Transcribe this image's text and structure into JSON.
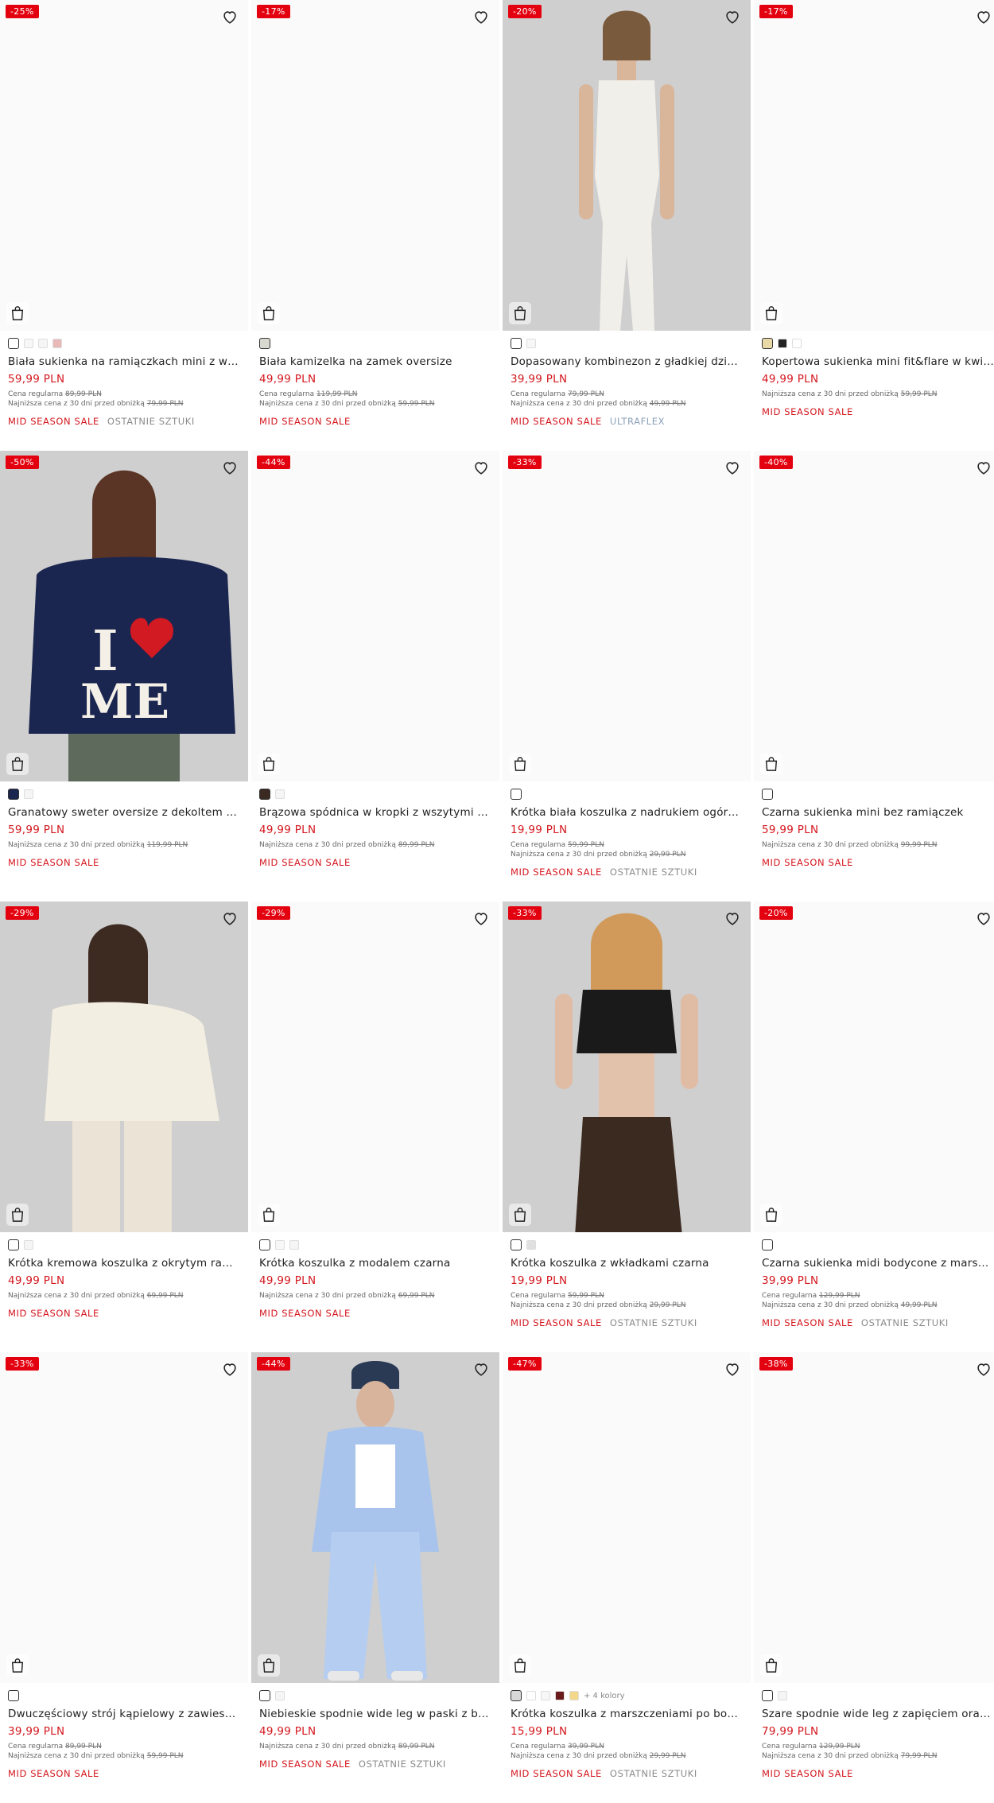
{
  "colors": {
    "accent": "#d4161d",
    "badge": "#e3000f"
  },
  "products": [
    {
      "discount": "-25%",
      "title": "Biała sukienka na ramiączkach mini z wiskozy",
      "price": "59,99 PLN",
      "regular_label": "Cena regularna",
      "regular_price": "89,99 PLN",
      "lowest_label": "Najniższa cena z 30 dni przed obniżką",
      "lowest_price": "79,99 PLN",
      "tag_sale": "MID SEASON SALE",
      "tag_extra": "OSTATNIE SZTUKI",
      "photo": false,
      "swatches": [
        "#ffffff",
        "#f7f7f7",
        "#f5f5f5",
        "#e8b9b9"
      ]
    },
    {
      "discount": "-17%",
      "title": "Biała kamizelka na zamek oversize",
      "price": "49,99 PLN",
      "regular_label": "Cena regularna",
      "regular_price": "119,99 PLN",
      "lowest_label": "Najniższa cena z 30 dni przed obniżką",
      "lowest_price": "59,99 PLN",
      "tag_sale": "MID SEASON SALE",
      "tag_extra": "",
      "photo": false,
      "swatches": [
        "#d8d8d0"
      ]
    },
    {
      "discount": "-20%",
      "title": "Dopasowany kombinezon z gładkiej dzianiny ULTRAFLEX",
      "price": "39,99 PLN",
      "regular_label": "Cena regularna",
      "regular_price": "79,99 PLN",
      "lowest_label": "Najniższa cena z 30 dni przed obniżką",
      "lowest_price": "49,99 PLN",
      "tag_sale": "MID SEASON SALE",
      "tag_extra": "ULTRAFLEX",
      "photo": true,
      "swatches": [
        "#ffffff",
        "#f7f7f7"
      ]
    },
    {
      "discount": "-17%",
      "title": "Kopertowa sukienka mini fit&flare w kwiaty z wiskozy",
      "price": "49,99 PLN",
      "regular_label": "",
      "regular_price": "",
      "lowest_label": "Najniższa cena z 30 dni przed obniżką",
      "lowest_price": "59,99 PLN",
      "tag_sale": "MID SEASON SALE",
      "tag_extra": "",
      "photo": false,
      "swatches": [
        "#e9d9a7",
        "#222222",
        "#ffffff"
      ]
    },
    {
      "discount": "-50%",
      "title": "Granatowy sweter oversize z dekoltem open shoulder I LOVE ME",
      "price": "59,99 PLN",
      "regular_label": "",
      "regular_price": "",
      "lowest_label": "Najniższa cena z 30 dni przed obniżką",
      "lowest_price": "119,99 PLN",
      "tag_sale": "MID SEASON SALE",
      "tag_extra": "",
      "photo": true,
      "swatches": [
        "#1b2650",
        "#f5f5f5"
      ]
    },
    {
      "discount": "-44%",
      "title": "Brązowa spódnica w kropki z wszytymi spodenkami",
      "price": "49,99 PLN",
      "regular_label": "",
      "regular_price": "",
      "lowest_label": "Najniższa cena z 30 dni przed obniżką",
      "lowest_price": "89,99 PLN",
      "tag_sale": "MID SEASON SALE",
      "tag_extra": "",
      "photo": false,
      "swatches": [
        "#3b2a22",
        "#f5f5f5"
      ]
    },
    {
      "discount": "-33%",
      "title": "Krótka biała koszulka z nadrukiem ogórków",
      "price": "19,99 PLN",
      "regular_label": "Cena regularna",
      "regular_price": "59,99 PLN",
      "lowest_label": "Najniższa cena z 30 dni przed obniżką",
      "lowest_price": "29,99 PLN",
      "tag_sale": "MID SEASON SALE",
      "tag_extra": "OSTATNIE SZTUKI",
      "photo": false,
      "swatches": [
        "#ffffff"
      ]
    },
    {
      "discount": "-40%",
      "title": "Czarna sukienka mini bez ramiączek",
      "price": "59,99 PLN",
      "regular_label": "",
      "regular_price": "",
      "lowest_label": "Najniższa cena z 30 dni przed obniżką",
      "lowest_price": "99,99 PLN",
      "tag_sale": "MID SEASON SALE",
      "tag_extra": "",
      "photo": false,
      "swatches": [
        "#ffffff"
      ]
    },
    {
      "discount": "-29%",
      "title": "Krótka kremowa koszulka z okrytym ramieniem",
      "price": "49,99 PLN",
      "regular_label": "",
      "regular_price": "",
      "lowest_label": "Najniższa cena z 30 dni przed obniżką",
      "lowest_price": "69,99 PLN",
      "tag_sale": "MID SEASON SALE",
      "tag_extra": "",
      "photo": true,
      "swatches": [
        "#ffffff",
        "#f5f5f5"
      ]
    },
    {
      "discount": "-29%",
      "title": "Krótka koszulka z modalem czarna",
      "price": "49,99 PLN",
      "regular_label": "",
      "regular_price": "",
      "lowest_label": "Najniższa cena z 30 dni przed obniżką",
      "lowest_price": "69,99 PLN",
      "tag_sale": "MID SEASON SALE",
      "tag_extra": "",
      "photo": false,
      "swatches": [
        "#ffffff",
        "#f7f7f7",
        "#f5f5f5"
      ]
    },
    {
      "discount": "-33%",
      "title": "Krótka koszulka z wkładkami czarna",
      "price": "19,99 PLN",
      "regular_label": "Cena regularna",
      "regular_price": "59,99 PLN",
      "lowest_label": "Najniższa cena z 30 dni przed obniżką",
      "lowest_price": "29,99 PLN",
      "tag_sale": "MID SEASON SALE",
      "tag_extra": "OSTATNIE SZTUKI",
      "photo": true,
      "swatches": [
        "#ffffff",
        "#e0e0e0"
      ]
    },
    {
      "discount": "-20%",
      "title": "Czarna sukienka midi bodycone z marszczeniami",
      "price": "39,99 PLN",
      "regular_label": "Cena regularna",
      "regular_price": "129,99 PLN",
      "lowest_label": "Najniższa cena z 30 dni przed obniżką",
      "lowest_price": "49,99 PLN",
      "tag_sale": "MID SEASON SALE",
      "tag_extra": "OSTATNIE SZTUKI",
      "photo": false,
      "swatches": [
        "#ffffff"
      ]
    },
    {
      "discount": "-33%",
      "title": "Dwuczęściowy strój kąpielowy z zawieszką koralikową",
      "price": "39,99 PLN",
      "regular_label": "Cena regularna",
      "regular_price": "89,99 PLN",
      "lowest_label": "Najniższa cena z 30 dni przed obniżką",
      "lowest_price": "59,99 PLN",
      "tag_sale": "MID SEASON SALE",
      "tag_extra": "",
      "photo": false,
      "swatches": [
        "#ffffff"
      ]
    },
    {
      "discount": "-44%",
      "title": "Niebieskie spodnie wide leg w paski z bielizną",
      "price": "49,99 PLN",
      "regular_label": "",
      "regular_price": "",
      "lowest_label": "Najniższa cena z 30 dni przed obniżką",
      "lowest_price": "89,99 PLN",
      "tag_sale": "MID SEASON SALE",
      "tag_extra": "OSTATNIE SZTUKI",
      "photo": true,
      "swatches": [
        "#ffffff",
        "#f5f5f5"
      ]
    },
    {
      "discount": "-47%",
      "title": "Krótka koszulka z marszczeniami po bokach czarna",
      "price": "15,99 PLN",
      "regular_label": "Cena regularna",
      "regular_price": "39,99 PLN",
      "lowest_label": "Najniższa cena z 30 dni przed obniżką",
      "lowest_price": "29,99 PLN",
      "tag_sale": "MID SEASON SALE",
      "tag_extra": "OSTATNIE SZTUKI",
      "photo": false,
      "swatches": [
        "#d8d8d8",
        "#ffffff",
        "#f7f7f7",
        "#6b1b1b",
        "#f3d88c"
      ],
      "more_colors": "+ 4 kolory"
    },
    {
      "discount": "-38%",
      "title": "Szare spodnie wide leg z zapięciem oraz wiązaniem",
      "price": "79,99 PLN",
      "regular_label": "Cena regularna",
      "regular_price": "129,99 PLN",
      "lowest_label": "Najniższa cena z 30 dni przed obniżką",
      "lowest_price": "79,99 PLN",
      "tag_sale": "MID SEASON SALE",
      "tag_extra": "",
      "photo": false,
      "swatches": [
        "#ffffff",
        "#f5f5f5"
      ]
    }
  ]
}
